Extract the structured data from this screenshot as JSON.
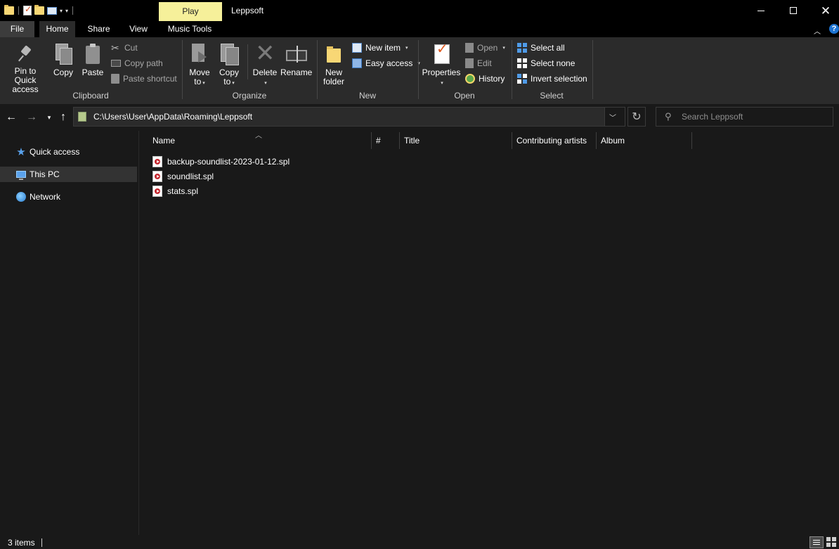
{
  "window": {
    "title": "Leppsoft",
    "context_tab": "Play",
    "context_color": "#f6f09a"
  },
  "ribbon_tabs": {
    "file": "File",
    "home": "Home",
    "share": "Share",
    "view": "View",
    "music_tools": "Music Tools"
  },
  "clipboard": {
    "pin_line1": "Pin to Quick",
    "pin_line2": "access",
    "copy": "Copy",
    "paste": "Paste",
    "cut": "Cut",
    "copy_path": "Copy path",
    "paste_shortcut": "Paste shortcut",
    "label": "Clipboard"
  },
  "organize": {
    "move_line1": "Move",
    "move_line2": "to",
    "copy_line1": "Copy",
    "copy_line2": "to",
    "delete": "Delete",
    "rename": "Rename",
    "label": "Organize"
  },
  "new_group": {
    "new_item": "New item",
    "easy_access": "Easy access",
    "new_folder_line1": "New",
    "new_folder_line2": "folder",
    "label": "New"
  },
  "open_group": {
    "properties": "Properties",
    "open": "Open",
    "edit": "Edit",
    "history": "History",
    "label": "Open"
  },
  "select_group": {
    "select_all": "Select all",
    "select_none": "Select none",
    "invert_selection": "Invert selection",
    "label": "Select"
  },
  "address": {
    "path": "C:\\Users\\User\\AppData\\Roaming\\Leppsoft",
    "search_placeholder": "Search Leppsoft"
  },
  "nav_pane": {
    "items": [
      {
        "label": "Quick access",
        "icon": "star-icon",
        "selected": false
      },
      {
        "label": "This PC",
        "icon": "computer-icon",
        "selected": true
      },
      {
        "label": "Network",
        "icon": "network-icon",
        "selected": false
      }
    ]
  },
  "columns": {
    "name": "Name",
    "number": "#",
    "title": "Title",
    "contributing_artists": "Contributing artists",
    "album": "Album"
  },
  "files": [
    {
      "name": "backup-soundlist-2023-01-12.spl"
    },
    {
      "name": "soundlist.spl"
    },
    {
      "name": "stats.spl"
    }
  ],
  "status": {
    "item_count": "3 items"
  }
}
